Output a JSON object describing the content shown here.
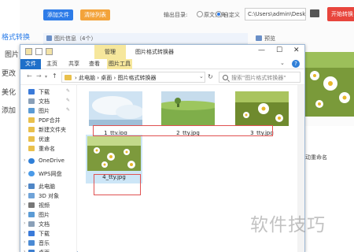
{
  "app": {
    "sidebar": {
      "format_label": "格式转换",
      "image_label": "图片",
      "change_label": "更改",
      "beautify_label": "美化",
      "add_label": "添加"
    },
    "toolbar": {
      "add_file": "添加文件",
      "clear_list": "清除列表",
      "output_dir_label": "输出目录:",
      "orig_folder_option": "原文件夹",
      "custom_option": "自定义",
      "output_path": "C:\\Users\\admin\\Deskto",
      "start_button": "开始转换"
    },
    "image_info_label": "图片信息（4个）",
    "preview_label": "预览",
    "rename_label": "动重命名"
  },
  "explorer": {
    "manage_tab": "管理",
    "title": "图片格式转换器",
    "ribbon_tabs": [
      "文件",
      "主页",
      "共享",
      "查看",
      "图片工具"
    ],
    "address_path": "› 此电脑 › 桌面 › 图片格式转换器",
    "search_placeholder": "搜索\"图片格式转换器\"",
    "nav_items": [
      {
        "label": "下载",
        "icon": "download-icon"
      },
      {
        "label": "文档",
        "icon": "document-icon"
      },
      {
        "label": "图片",
        "icon": "picture-icon"
      },
      {
        "label": "PDF合并",
        "icon": "folder-icon"
      },
      {
        "label": "新建文件夹",
        "icon": "folder-icon"
      },
      {
        "label": "优速",
        "icon": "folder-icon"
      },
      {
        "label": "重命名",
        "icon": "folder-icon"
      },
      {
        "label": "OneDrive",
        "icon": "cloud-icon"
      },
      {
        "label": "WPS网盘",
        "icon": "cloud-icon"
      },
      {
        "label": "此电脑",
        "icon": "computer-icon"
      },
      {
        "label": "3D 对象",
        "icon": "cube-icon"
      },
      {
        "label": "视频",
        "icon": "video-icon"
      },
      {
        "label": "图片",
        "icon": "picture-icon"
      },
      {
        "label": "文档",
        "icon": "document-icon"
      },
      {
        "label": "下载",
        "icon": "download-icon"
      },
      {
        "label": "音乐",
        "icon": "music-icon"
      },
      {
        "label": "桌面",
        "icon": "desktop-icon"
      }
    ],
    "files": [
      {
        "name": "1_tty.jpg"
      },
      {
        "name": "2_tty.jpg"
      },
      {
        "name": "3_tty.jpg"
      },
      {
        "name": "4_tty.jpg"
      }
    ]
  },
  "watermark": "软件技巧",
  "colors": {
    "accent_blue": "#2e7ce8",
    "clear_orange": "#f3a33a",
    "start_red": "#e8453c",
    "highlight_red": "#e05252",
    "manage_yellow": "#f6e79c"
  }
}
